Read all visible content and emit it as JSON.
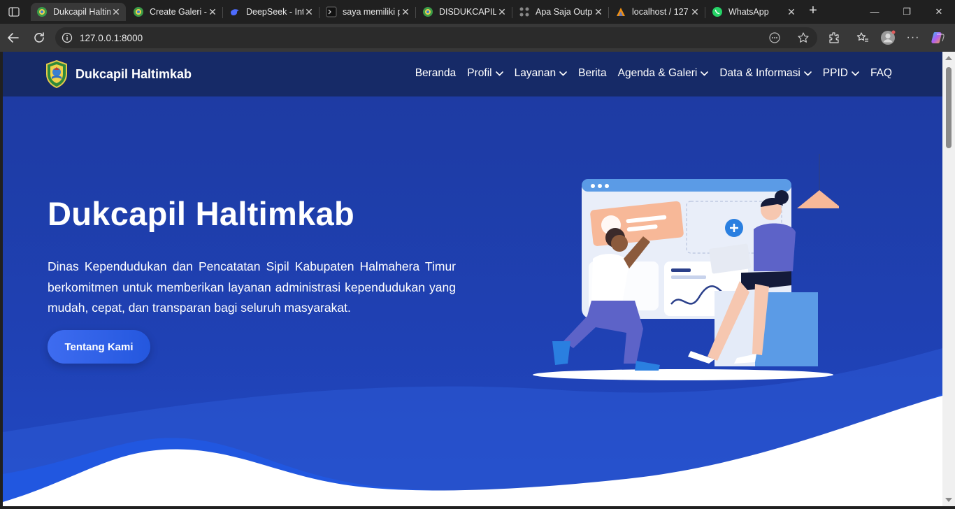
{
  "browser": {
    "tabs": [
      {
        "title": "Dukcapil Haltim",
        "active": true,
        "icon": "site-logo-icon"
      },
      {
        "title": "Create Galeri -",
        "active": false,
        "icon": "site-logo-icon"
      },
      {
        "title": "DeepSeek - Int",
        "active": false,
        "icon": "deepseek-icon"
      },
      {
        "title": "saya memiliki p",
        "active": false,
        "icon": "terminal-icon"
      },
      {
        "title": "DISDUKCAPIL",
        "active": false,
        "icon": "site-logo-icon"
      },
      {
        "title": "Apa Saja Outp",
        "active": false,
        "icon": "joomla-icon"
      },
      {
        "title": "localhost / 127",
        "active": false,
        "icon": "phpmyadmin-icon"
      },
      {
        "title": "WhatsApp",
        "active": false,
        "icon": "whatsapp-icon"
      }
    ],
    "url": "127.0.0.1:8000"
  },
  "site": {
    "brand": "Dukcapil Haltimkab",
    "menu": [
      {
        "label": "Beranda",
        "dropdown": false
      },
      {
        "label": "Profil",
        "dropdown": true
      },
      {
        "label": "Layanan",
        "dropdown": true
      },
      {
        "label": "Berita",
        "dropdown": false
      },
      {
        "label": "Agenda & Galeri",
        "dropdown": true
      },
      {
        "label": "Data & Informasi",
        "dropdown": true
      },
      {
        "label": "PPID",
        "dropdown": true
      },
      {
        "label": "FAQ",
        "dropdown": false
      }
    ]
  },
  "hero": {
    "title": "Dukcapil Haltimkab",
    "description": "Dinas Kependudukan dan Pencatatan Sipil Kabupaten Halmahera Timur berkomitmen untuk memberikan layanan administrasi kependudukan yang mudah, cepat, dan transparan bagi seluruh masyarakat.",
    "cta": "Tentang Kami"
  },
  "colors": {
    "nav_bg": "#162a67",
    "hero_bg": "#1f41b4",
    "cta": "#2f5fe8",
    "accent_peach": "#f7b898",
    "illustration_blue": "#5b9be6"
  }
}
